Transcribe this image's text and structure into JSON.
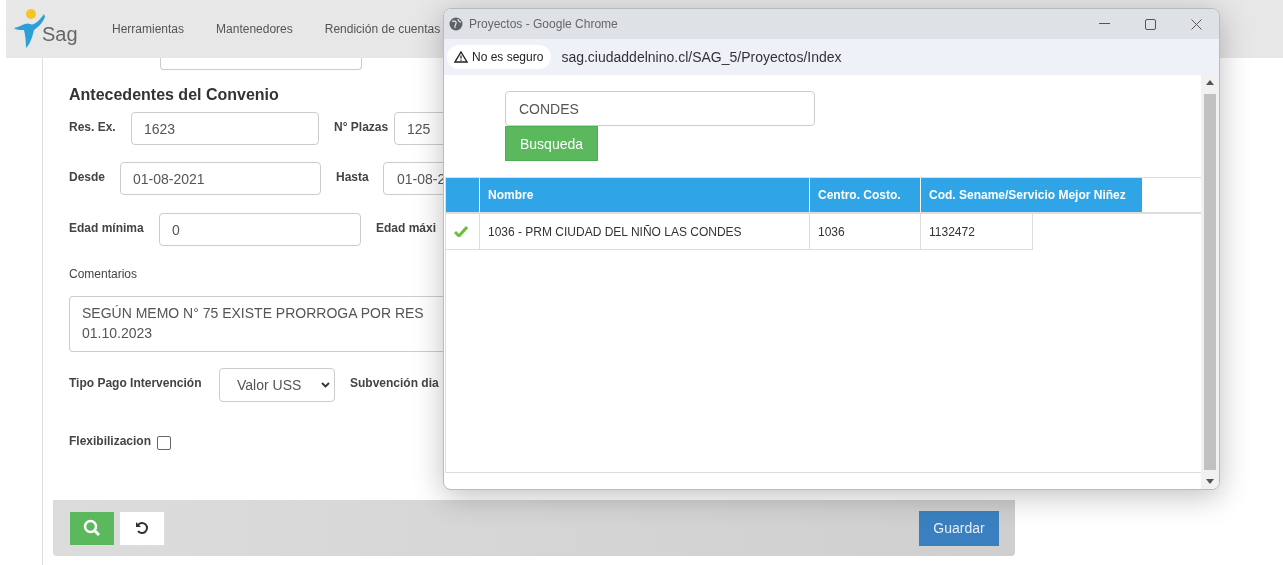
{
  "navbar": {
    "brand": "Sag",
    "links": [
      "Herramientas",
      "Mantenedores",
      "Rendición de cuentas"
    ]
  },
  "form": {
    "heading": "Antecedentes del Convenio",
    "rows": [
      {
        "kind": "pair",
        "items": [
          {
            "label": "Res. Ex.",
            "value": "1623"
          },
          {
            "label": "N° Plazas",
            "value": "125"
          }
        ]
      },
      {
        "kind": "pair",
        "items": [
          {
            "label": "Desde",
            "value": "01-08-2021"
          },
          {
            "label": "Hasta",
            "value": "01-08-2"
          }
        ]
      },
      {
        "kind": "pair",
        "items": [
          {
            "label": "Edad mínima",
            "value": "0"
          },
          {
            "label": "Edad máxi"
          }
        ]
      },
      {
        "kind": "textarea",
        "label": "Comentarios",
        "lines": [
          "SEGÚN MEMO N° 75 EXISTE PRORROGA POR RES",
          "01.10.2023"
        ]
      },
      {
        "kind": "select",
        "label": "Tipo Pago Intervención",
        "value": "Valor USS",
        "next_label": "Subvención dia"
      },
      {
        "kind": "checkbox",
        "label": "Flexibilizacion",
        "checked": false
      }
    ],
    "save_button": "Guardar"
  },
  "popup": {
    "title": "Proyectos - Google Chrome",
    "security": "No es seguro",
    "url": "sag.ciudaddelnino.cl/SAG_5/Proyectos/Index",
    "search": {
      "value": "CONDES",
      "button": "Busqueda"
    },
    "table": {
      "columns": [
        "Nombre",
        "Centro. Costo.",
        "Cod. Sename/Servicio Mejor Niñez"
      ],
      "rows": [
        {
          "selected": true,
          "cells": [
            "1036 - PRM CIUDAD DEL NIÑO LAS CONDES",
            "1036",
            "1132472"
          ]
        }
      ]
    }
  }
}
